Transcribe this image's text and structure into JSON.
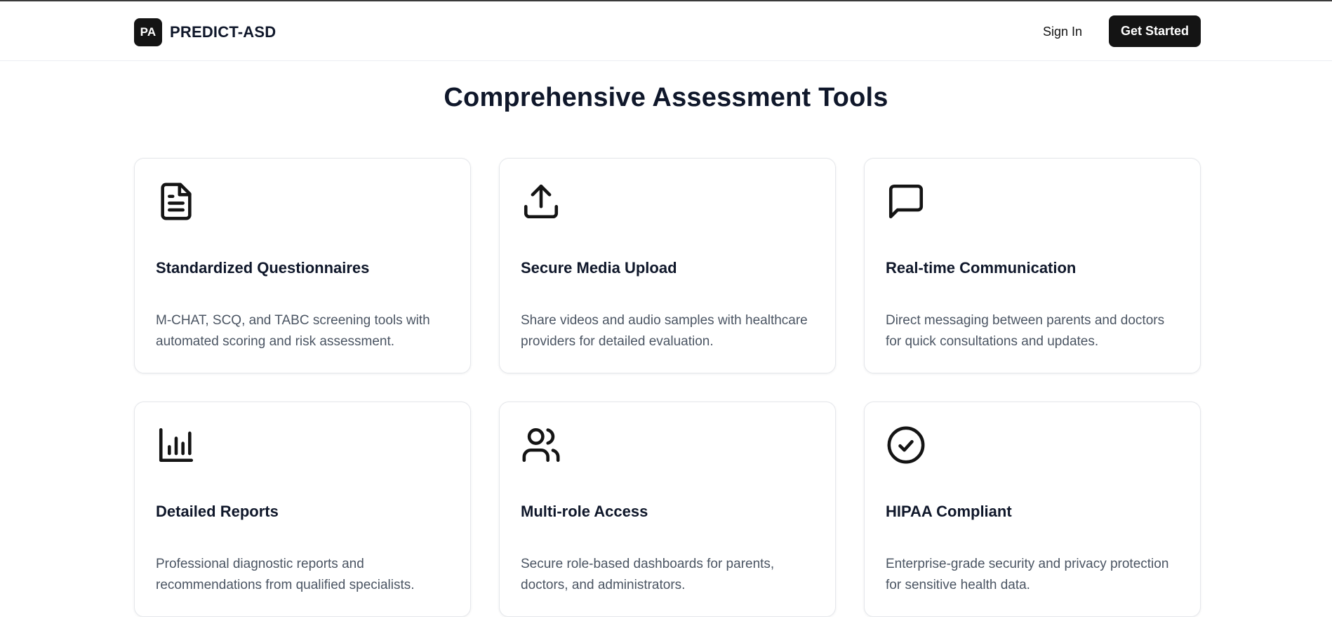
{
  "header": {
    "logo_badge": "PA",
    "brand": "PREDICT-ASD",
    "sign_in_label": "Sign In",
    "get_started_label": "Get Started"
  },
  "main": {
    "title": "Comprehensive Assessment Tools",
    "features": [
      {
        "icon": "document-icon",
        "title": "Standardized Questionnaires",
        "description": "M-CHAT, SCQ, and TABC screening tools with automated scoring and risk assessment."
      },
      {
        "icon": "upload-icon",
        "title": "Secure Media Upload",
        "description": "Share videos and audio samples with healthcare providers for detailed evaluation."
      },
      {
        "icon": "message-icon",
        "title": "Real-time Communication",
        "description": "Direct messaging between parents and doctors for quick consultations and updates."
      },
      {
        "icon": "bar-chart-icon",
        "title": "Detailed Reports",
        "description": "Professional diagnostic reports and recommendations from qualified specialists."
      },
      {
        "icon": "users-icon",
        "title": "Multi-role Access",
        "description": "Secure role-based dashboards for parents, doctors, and administrators."
      },
      {
        "icon": "check-circle-icon",
        "title": "HIPAA Compliant",
        "description": "Enterprise-grade security and privacy protection for sensitive health data."
      }
    ]
  },
  "colors": {
    "primary": "#141414",
    "text": "#0f172a",
    "muted": "#4b5563",
    "border": "#e5e7eb"
  }
}
